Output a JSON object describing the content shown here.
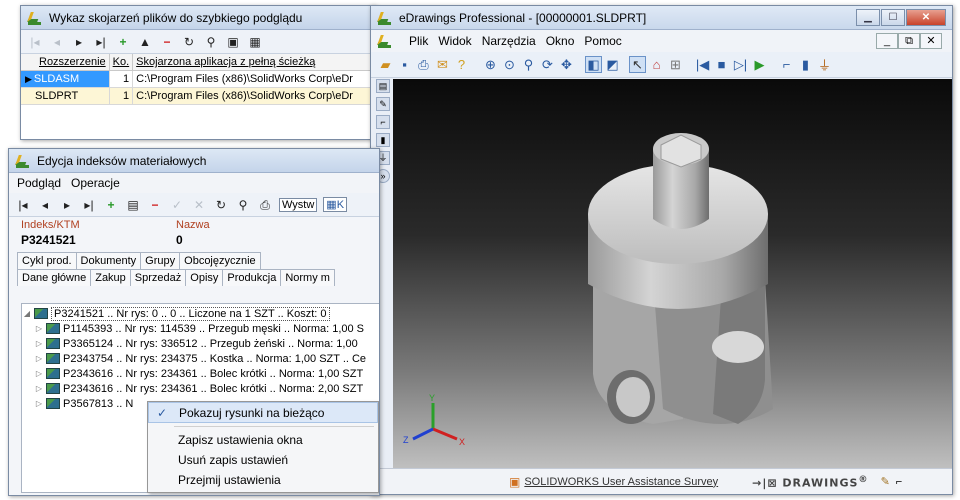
{
  "win1": {
    "title": "Wykaz skojarzeń plików do szybkiego podglądu",
    "columns": [
      "Rozszerzenie",
      "Ko.",
      "Skojarzona aplikacja z pełną ścieżką"
    ],
    "rows": [
      {
        "ext": "SLDASM",
        "count": "1",
        "path": "C:\\Program Files (x86)\\SolidWorks Corp\\eDr"
      },
      {
        "ext": "SLDPRT",
        "count": "1",
        "path": "C:\\Program Files (x86)\\SolidWorks Corp\\eDr"
      }
    ]
  },
  "win2": {
    "title": "Edycja indeksów materiałowych",
    "menu": [
      "Podgląd",
      "Operacje"
    ],
    "toolbar_text": [
      "Wystw",
      "K"
    ],
    "fields": {
      "index_label": "Indeks/KTM",
      "index_value": "P3241521",
      "name_label": "Nazwa",
      "name_value": "0"
    },
    "tabs_row1": [
      "Cykl prod.",
      "Dokumenty",
      "Grupy",
      "Obcojęzycznie"
    ],
    "tabs_row2": [
      "Dane główne",
      "Zakup",
      "Sprzedaż",
      "Opisy",
      "Produkcja",
      "Normy m"
    ],
    "tree": {
      "root": "P3241521 .. Nr rys: 0 .. 0 .. Liczone na 1 SZT .. Koszt: 0",
      "children": [
        "P1145393 .. Nr rys: 114539 .. Przegub męski .. Norma: 1,00 S",
        "P3365124 .. Nr rys: 336512 .. Przegub żeński .. Norma: 1,00",
        "P2343754 .. Nr rys: 234375 .. Kostka .. Norma: 1,00 SZT .. Ce",
        "P2343616 .. Nr rys: 234361 .. Bolec krótki .. Norma: 1,00 SZT",
        "P2343616 .. Nr rys: 234361 .. Bolec krótki .. Norma: 2,00 SZT",
        "P3567813 .. N"
      ]
    },
    "context_menu": {
      "checked_item": "Pokazuj rysunki na bieżąco",
      "items": [
        "Zapisz ustawienia okna",
        "Usuń zapis ustawień",
        "Przejmij ustawienia"
      ]
    }
  },
  "win3": {
    "title": "eDrawings Professional - [00000001.SLDPRT]",
    "menu": [
      "Plik",
      "Widok",
      "Narzędzia",
      "Okno",
      "Pomoc"
    ],
    "status_survey": "SOLIDWORKS User Assistance Survey",
    "status_brand": "DRAWINGS",
    "axes": {
      "x": "X",
      "y": "Y",
      "z": "Z"
    }
  }
}
